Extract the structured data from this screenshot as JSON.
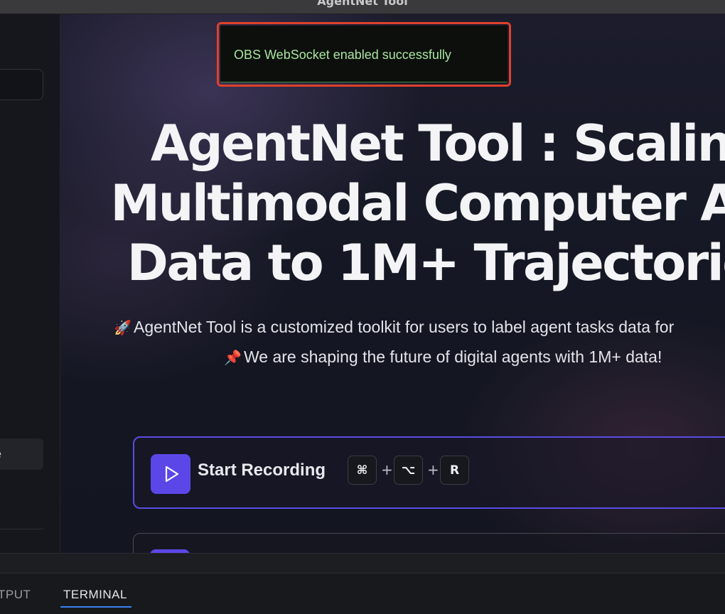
{
  "window": {
    "title": "AgentNet Tool"
  },
  "toast": {
    "message": "OBS WebSocket enabled successfully"
  },
  "sidebar": {
    "items": [
      {
        "label": "e"
      }
    ]
  },
  "hero": {
    "title_lines": [
      "AgentNet Tool : Scalin",
      "Multimodal Computer Ag",
      "Data to 1M+ Trajectorie"
    ],
    "description": [
      {
        "icon": "rocket-emoji",
        "glyph": "🚀",
        "text": "AgentNet Tool is a customized toolkit for users to label agent tasks data for"
      },
      {
        "icon": "pushpin-emoji",
        "glyph": "📌",
        "text": "We are shaping the future of digital agents with 1M+ data!"
      }
    ]
  },
  "record": {
    "label": "Start Recording",
    "icon": "play-icon",
    "shortcut": {
      "keys": [
        "⌘",
        "⌥",
        "R"
      ],
      "separator": "+"
    }
  },
  "panel": {
    "tabs": [
      {
        "label": "TPUT",
        "active": false
      },
      {
        "label": "TERMINAL",
        "active": true
      }
    ]
  },
  "colors": {
    "accent": "#5b47e8",
    "toast_border": "#e0402c",
    "toast_text": "#a9e4a0",
    "tab_underline": "#3b82f6"
  }
}
